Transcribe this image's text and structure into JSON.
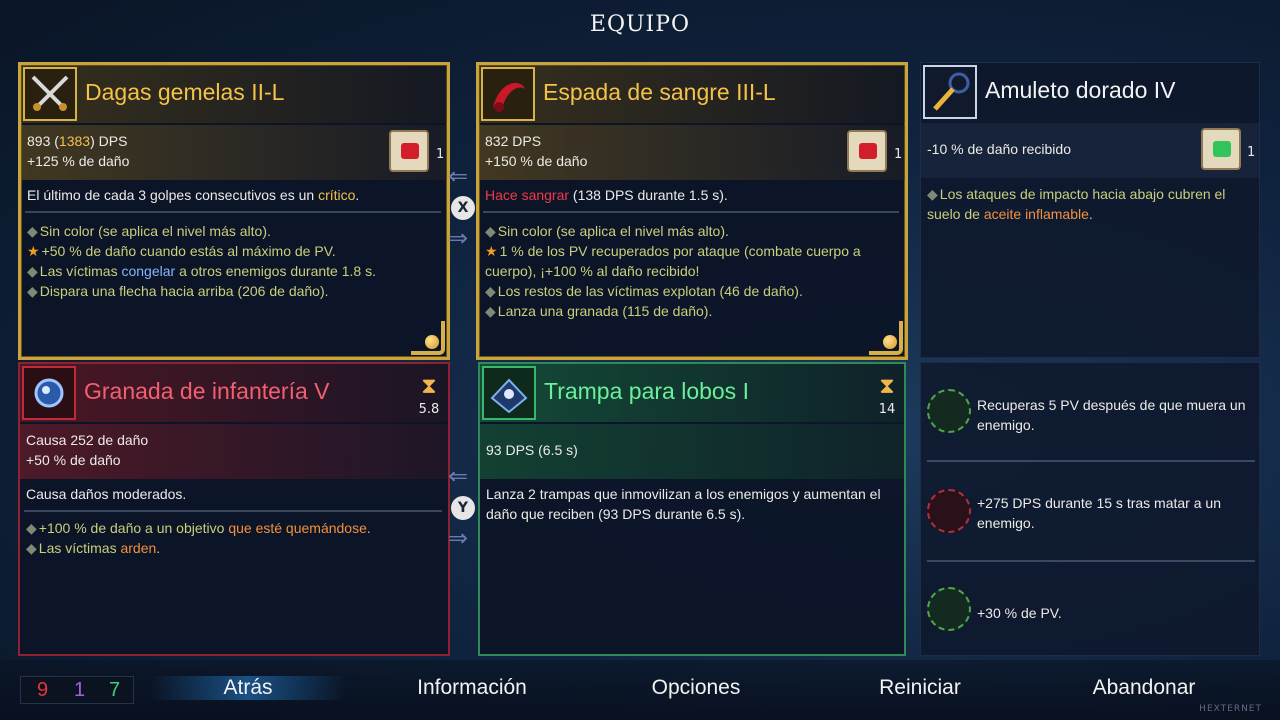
{
  "header": {
    "title": "EQUIPO"
  },
  "weapons": [
    {
      "name": "Dagas gemelas II-L",
      "icon": "twin-daggers-icon",
      "dps_base": "893",
      "dps_alt": "1383",
      "dps_suffix": "DPS",
      "damage": "+125 % de daño",
      "scroll_count": "1",
      "description_pre": "El último de cada 3 golpes consecutivos es un ",
      "description_hl": "crítico",
      "description_post": ".",
      "bullets": [
        {
          "marker": "dot",
          "text": "Sin color (se aplica el nivel más alto)."
        },
        {
          "marker": "star",
          "text": "+50 % de daño cuando estás al máximo de PV."
        },
        {
          "marker": "dot",
          "pre": "Las víctimas ",
          "hl": "congelar",
          "post": " a otros enemigos durante 1.8 s."
        },
        {
          "marker": "dot",
          "text": "Dispara una flecha hacia arriba (206 de daño)."
        }
      ]
    },
    {
      "name": "Espada de sangre III-L",
      "icon": "blood-sword-icon",
      "dps": "832 DPS",
      "damage": "+150 % de daño",
      "scroll_count": "1",
      "description_hl": "Hace sangrar",
      "description_post": " (138 DPS durante 1.5 s).",
      "bullets": [
        {
          "marker": "dot",
          "text": "Sin color (se aplica el nivel más alto)."
        },
        {
          "marker": "star",
          "text": "1 % de los PV recuperados por ataque (combate cuerpo a"
        },
        {
          "marker": "none",
          "text": "cuerpo), ¡+100 % al daño recibido!"
        },
        {
          "marker": "dot",
          "text": "Los restos de las víctimas explotan (46 de daño)."
        },
        {
          "marker": "dot",
          "text": "Lanza una granada (115 de daño)."
        }
      ]
    }
  ],
  "amulet": {
    "name": "Amuleto dorado IV",
    "icon": "golden-amulet-icon",
    "stat": "-10 % de daño recibido",
    "scroll_count": "1",
    "bullet_pre": "Los ataques de impacto hacia abajo cubren el",
    "bullet_line2_pre": "suelo de ",
    "bullet_hl": "aceite inflamable",
    "bullet_post": "."
  },
  "skills": [
    {
      "name": "Granada de infantería V",
      "icon": "grenade-icon",
      "cooldown": "5.8",
      "stat1": "Causa 252 de daño",
      "stat2": "+50 % de daño",
      "description": "Causa daños moderados.",
      "bullet1_pre": "+100 % de daño a un objetivo ",
      "bullet1_hl": "que esté quemándose",
      "bullet1_post": ".",
      "bullet2_pre": "Las víctimas ",
      "bullet2_hl": "arden",
      "bullet2_post": "."
    },
    {
      "name": "Trampa para lobos I",
      "icon": "wolf-trap-icon",
      "cooldown": "14",
      "stat1": "93 DPS (6.5 s)",
      "description_line1": "Lanza 2 trampas que inmovilizan a los enemigos y aumentan el",
      "description_line2": "daño que reciben (93 DPS durante 6.5 s)."
    }
  ],
  "mutations": [
    {
      "icon": "vampire-mouth-icon",
      "line1": "Recuperas 5 PV después de que muera un",
      "line2": "enemigo."
    },
    {
      "icon": "crossbow-icon",
      "line1": "+275 DPS durante 15 s tras matar a un",
      "line2": "enemigo."
    },
    {
      "icon": "health-potion-icon",
      "line1": "+30 % de PV.",
      "line2": ""
    }
  ],
  "swap_keys": {
    "top": "X",
    "bottom": "Y"
  },
  "stats_counters": {
    "brutality": "9",
    "tactics": "1",
    "survival": "7",
    "colors": {
      "brutality": "#e8323f",
      "tactics": "#a65ee0",
      "survival": "#3ecf74"
    }
  },
  "menu": {
    "back": "Atrás",
    "info": "Información",
    "options": "Opciones",
    "restart": "Reiniciar",
    "quit": "Abandonar"
  },
  "watermark": "HEXTERNET"
}
